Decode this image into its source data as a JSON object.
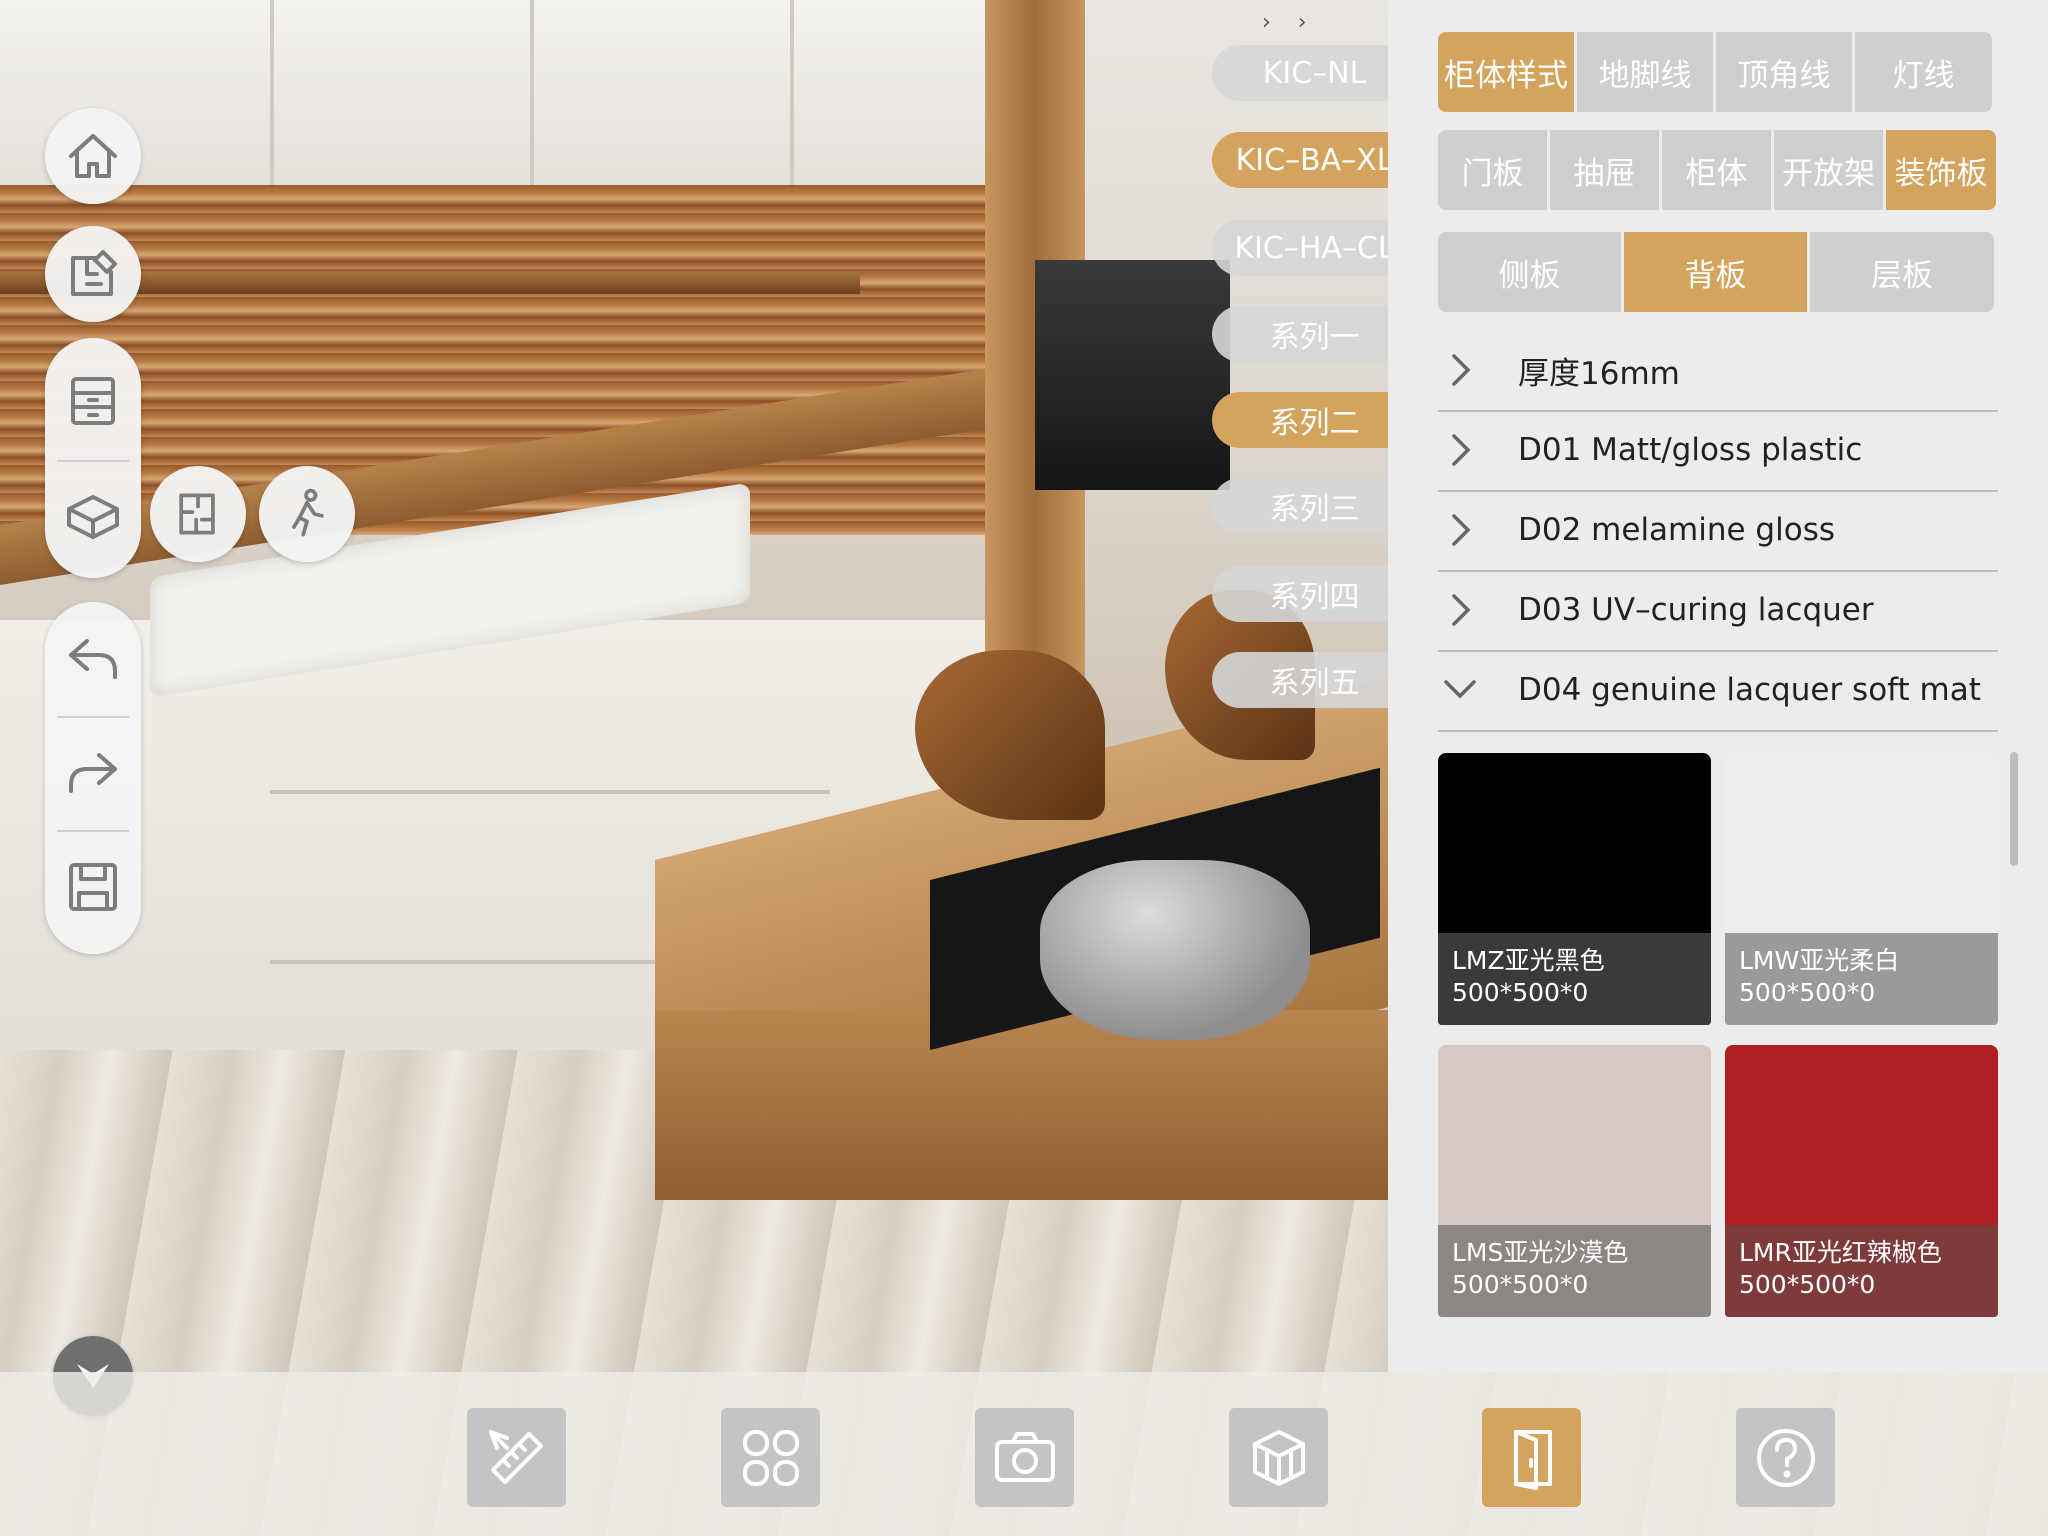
{
  "series_list": [
    {
      "label": "KIC–NL",
      "active": false
    },
    {
      "label": "KIC–BA–XL",
      "active": true
    },
    {
      "label": "KIC–HA–CL",
      "active": false
    },
    {
      "label": "系列一",
      "active": false
    },
    {
      "label": "系列二",
      "active": true
    },
    {
      "label": "系列三",
      "active": false
    },
    {
      "label": "系列四",
      "active": false
    },
    {
      "label": "系列五",
      "active": false
    }
  ],
  "panel": {
    "tabs_row1": [
      {
        "label": "柜体样式",
        "active": true
      },
      {
        "label": "地脚线",
        "active": false
      },
      {
        "label": "顶角线",
        "active": false
      },
      {
        "label": "灯线",
        "active": false
      }
    ],
    "tabs_row2": [
      {
        "label": "门板",
        "active": false
      },
      {
        "label": "抽屉",
        "active": false
      },
      {
        "label": "柜体",
        "active": false
      },
      {
        "label": "开放架",
        "active": false
      },
      {
        "label": "装饰板",
        "active": true
      }
    ],
    "tabs_row3": [
      {
        "label": "侧板",
        "active": false
      },
      {
        "label": "背板",
        "active": true
      },
      {
        "label": "层板",
        "active": false
      }
    ],
    "accordion": [
      {
        "label": "厚度16mm",
        "expanded": false
      },
      {
        "label": "D01 Matt/gloss plastic",
        "expanded": false
      },
      {
        "label": "D02 melamine gloss",
        "expanded": false
      },
      {
        "label": "D03 UV–curing lacquer",
        "expanded": false
      },
      {
        "label": "D04 genuine lacquer soft mat",
        "expanded": true
      }
    ],
    "swatches": [
      {
        "name": "LMZ亚光黑色",
        "size": "500*500*0",
        "color": "#000000",
        "caption_bg": "#3a3a3a"
      },
      {
        "name": "LMW亚光柔白",
        "size": "500*500*0",
        "color": "#efeeec",
        "caption_bg": "#9a9a9a"
      },
      {
        "name": "LMS亚光沙漠色",
        "size": "500*500*0",
        "color": "#d6c8c2",
        "caption_bg": "#8c8684"
      },
      {
        "name": "LMR亚光红辣椒色",
        "size": "500*500*0",
        "color": "#ad1f23",
        "caption_bg": "#7f3a3c"
      }
    ]
  },
  "left_toolbar": {
    "icons": [
      "home-icon",
      "floorplan-edit-icon",
      "cabinet-icon",
      "3d-box-icon",
      "floorplan-icon",
      "walk-icon",
      "undo-icon",
      "redo-icon",
      "save-icon"
    ]
  },
  "bottom_toolbar": {
    "icons": [
      "measure-icon",
      "catalog-grid-icon",
      "camera-icon",
      "cube-icon",
      "door-icon",
      "help-icon"
    ],
    "active": "door-icon"
  },
  "colors": {
    "accent": "#d4a35d",
    "inactive": "#cfcfcf",
    "panel_bg": "#ececec"
  }
}
